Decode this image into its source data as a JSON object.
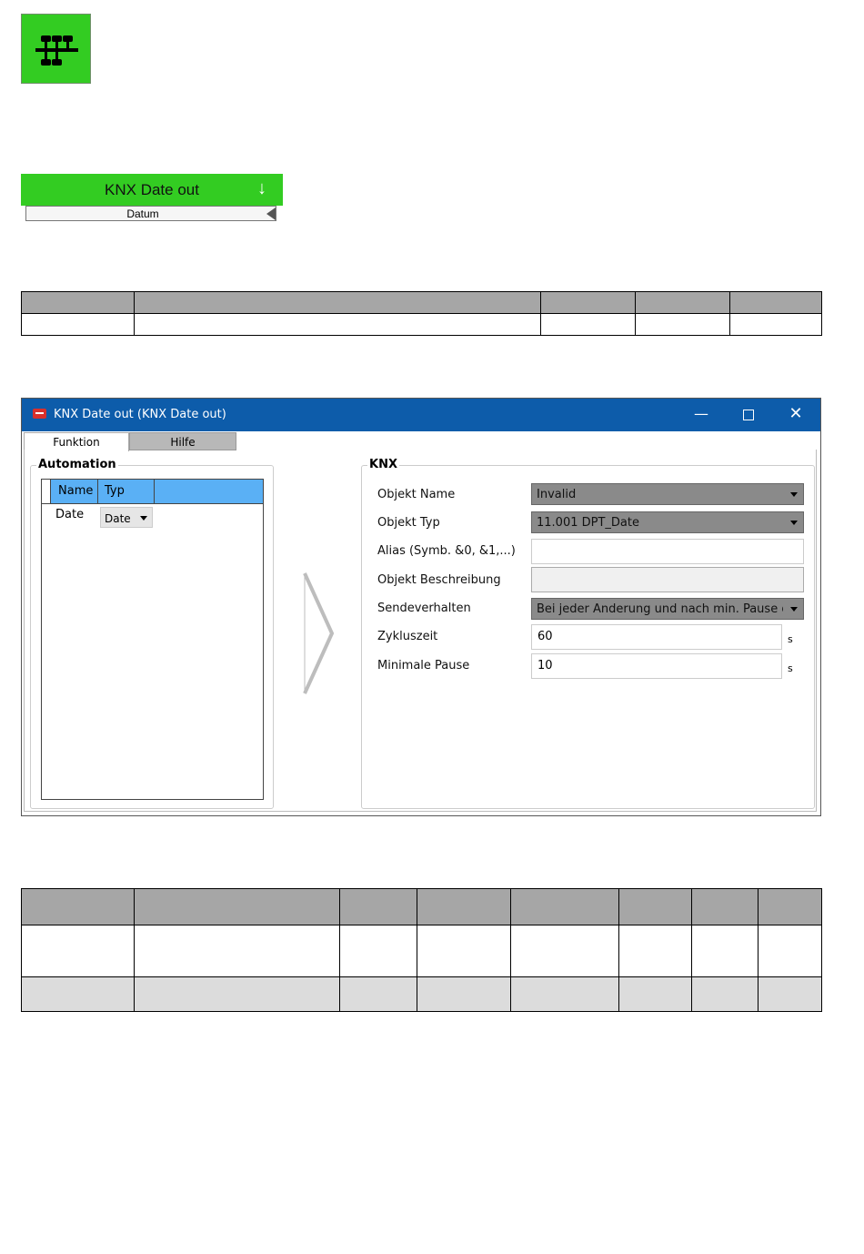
{
  "block": {
    "title": "KNX Date out",
    "direction_arrow": "↓",
    "input_port_label": "Datum",
    "icon": "network-bus-icon",
    "color": "#33cc22"
  },
  "dialog": {
    "title": "KNX Date out (KNX Date out)",
    "title_bar_color": "#0d5caa",
    "controls": {
      "minimize": "—",
      "maximize": "□",
      "close": "✕"
    },
    "tabs": [
      "Funktion",
      "Hilfe"
    ],
    "automation": {
      "label": "Automation",
      "columns": [
        "Name",
        "Typ"
      ],
      "rows": [
        {
          "name": "Date",
          "type": "Date"
        }
      ]
    },
    "knx": {
      "label": "KNX",
      "fields": {
        "objekt_name": {
          "label": "Objekt Name",
          "value": "Invalid"
        },
        "objekt_typ": {
          "label": "Objekt Typ",
          "value": "11.001 DPT_Date"
        },
        "alias": {
          "label": "Alias (Symb. &0, &1,...)",
          "value": ""
        },
        "beschreibung": {
          "label": "Objekt Beschreibung",
          "value": ""
        },
        "sendeverhalten": {
          "label": "Sendeverhalten",
          "value": "Bei jeder Änderung und nach min. Pause od"
        },
        "zykluszeit": {
          "label": "Zykluszeit",
          "value": "60",
          "unit": "s"
        },
        "minimale_pause": {
          "label": "Minimale Pause",
          "value": "10",
          "unit": "s"
        }
      }
    }
  }
}
